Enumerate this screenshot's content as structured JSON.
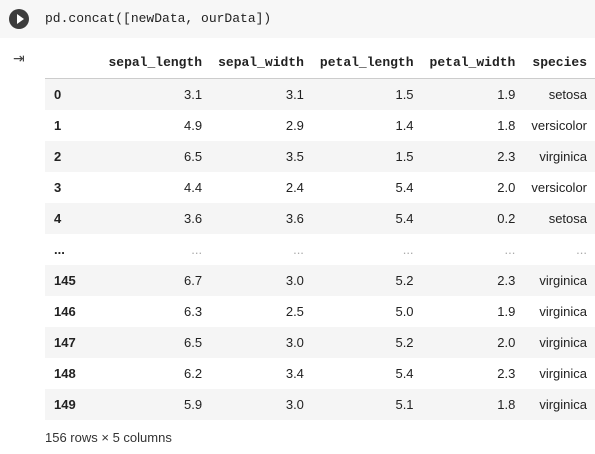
{
  "cell": {
    "code": "pd.concat([newData, ourData])"
  },
  "table": {
    "columns": [
      "sepal_length",
      "sepal_width",
      "petal_length",
      "petal_width",
      "species"
    ],
    "rows": [
      [
        "0",
        "3.1",
        "3.1",
        "1.5",
        "1.9",
        "setosa"
      ],
      [
        "1",
        "4.9",
        "2.9",
        "1.4",
        "1.8",
        "versicolor"
      ],
      [
        "2",
        "6.5",
        "3.5",
        "1.5",
        "2.3",
        "virginica"
      ],
      [
        "3",
        "4.4",
        "2.4",
        "5.4",
        "2.0",
        "versicolor"
      ],
      [
        "4",
        "3.6",
        "3.6",
        "5.4",
        "0.2",
        "setosa"
      ],
      [
        "...",
        "...",
        "...",
        "...",
        "...",
        "..."
      ],
      [
        "145",
        "6.7",
        "3.0",
        "5.2",
        "2.3",
        "virginica"
      ],
      [
        "146",
        "6.3",
        "2.5",
        "5.0",
        "1.9",
        "virginica"
      ],
      [
        "147",
        "6.5",
        "3.0",
        "5.2",
        "2.0",
        "virginica"
      ],
      [
        "148",
        "6.2",
        "3.4",
        "5.4",
        "2.3",
        "virginica"
      ],
      [
        "149",
        "5.9",
        "3.0",
        "5.1",
        "1.8",
        "virginica"
      ]
    ]
  },
  "footer": "156 rows × 5 columns"
}
